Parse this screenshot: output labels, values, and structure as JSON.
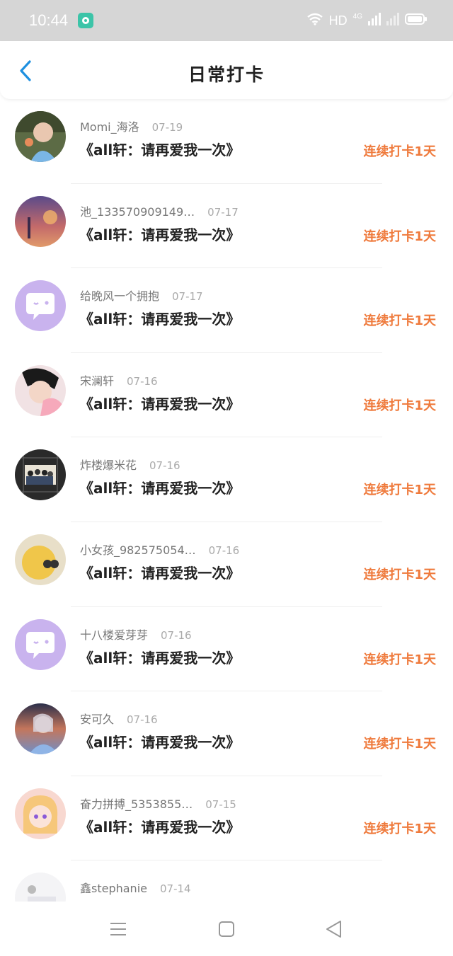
{
  "status_bar": {
    "time": "10:44",
    "network": "HD",
    "signal": "4G"
  },
  "header": {
    "title": "日常打卡"
  },
  "entries": [
    {
      "name": "Momi_海洛",
      "date": "07-19",
      "book": "《all轩：请再爱我一次》",
      "streak": "连续打卡1天"
    },
    {
      "name": "池_133570909149…",
      "date": "07-17",
      "book": "《all轩：请再爱我一次》",
      "streak": "连续打卡1天"
    },
    {
      "name": "给晚风一个拥抱",
      "date": "07-17",
      "book": "《all轩：请再爱我一次》",
      "streak": "连续打卡1天"
    },
    {
      "name": "宋澜轩",
      "date": "07-16",
      "book": "《all轩：请再爱我一次》",
      "streak": "连续打卡1天"
    },
    {
      "name": "炸楼爆米花",
      "date": "07-16",
      "book": "《all轩：请再爱我一次》",
      "streak": "连续打卡1天"
    },
    {
      "name": "小女孩_982575054…",
      "date": "07-16",
      "book": "《all轩：请再爱我一次》",
      "streak": "连续打卡1天"
    },
    {
      "name": "十八楼爱芽芽",
      "date": "07-16",
      "book": "《all轩：请再爱我一次》",
      "streak": "连续打卡1天"
    },
    {
      "name": "安可久",
      "date": "07-16",
      "book": "《all轩：请再爱我一次》",
      "streak": "连续打卡1天"
    },
    {
      "name": "奋力拼搏_5353855…",
      "date": "07-15",
      "book": "《all轩：请再爱我一次》",
      "streak": "连续打卡1天"
    },
    {
      "name": "鑫stephanie",
      "date": "07-14",
      "book": "",
      "streak": ""
    }
  ],
  "colors": {
    "accent": "#1e90e0",
    "streak": "#ef7a3c",
    "status_bar": "#d6d6d6"
  }
}
